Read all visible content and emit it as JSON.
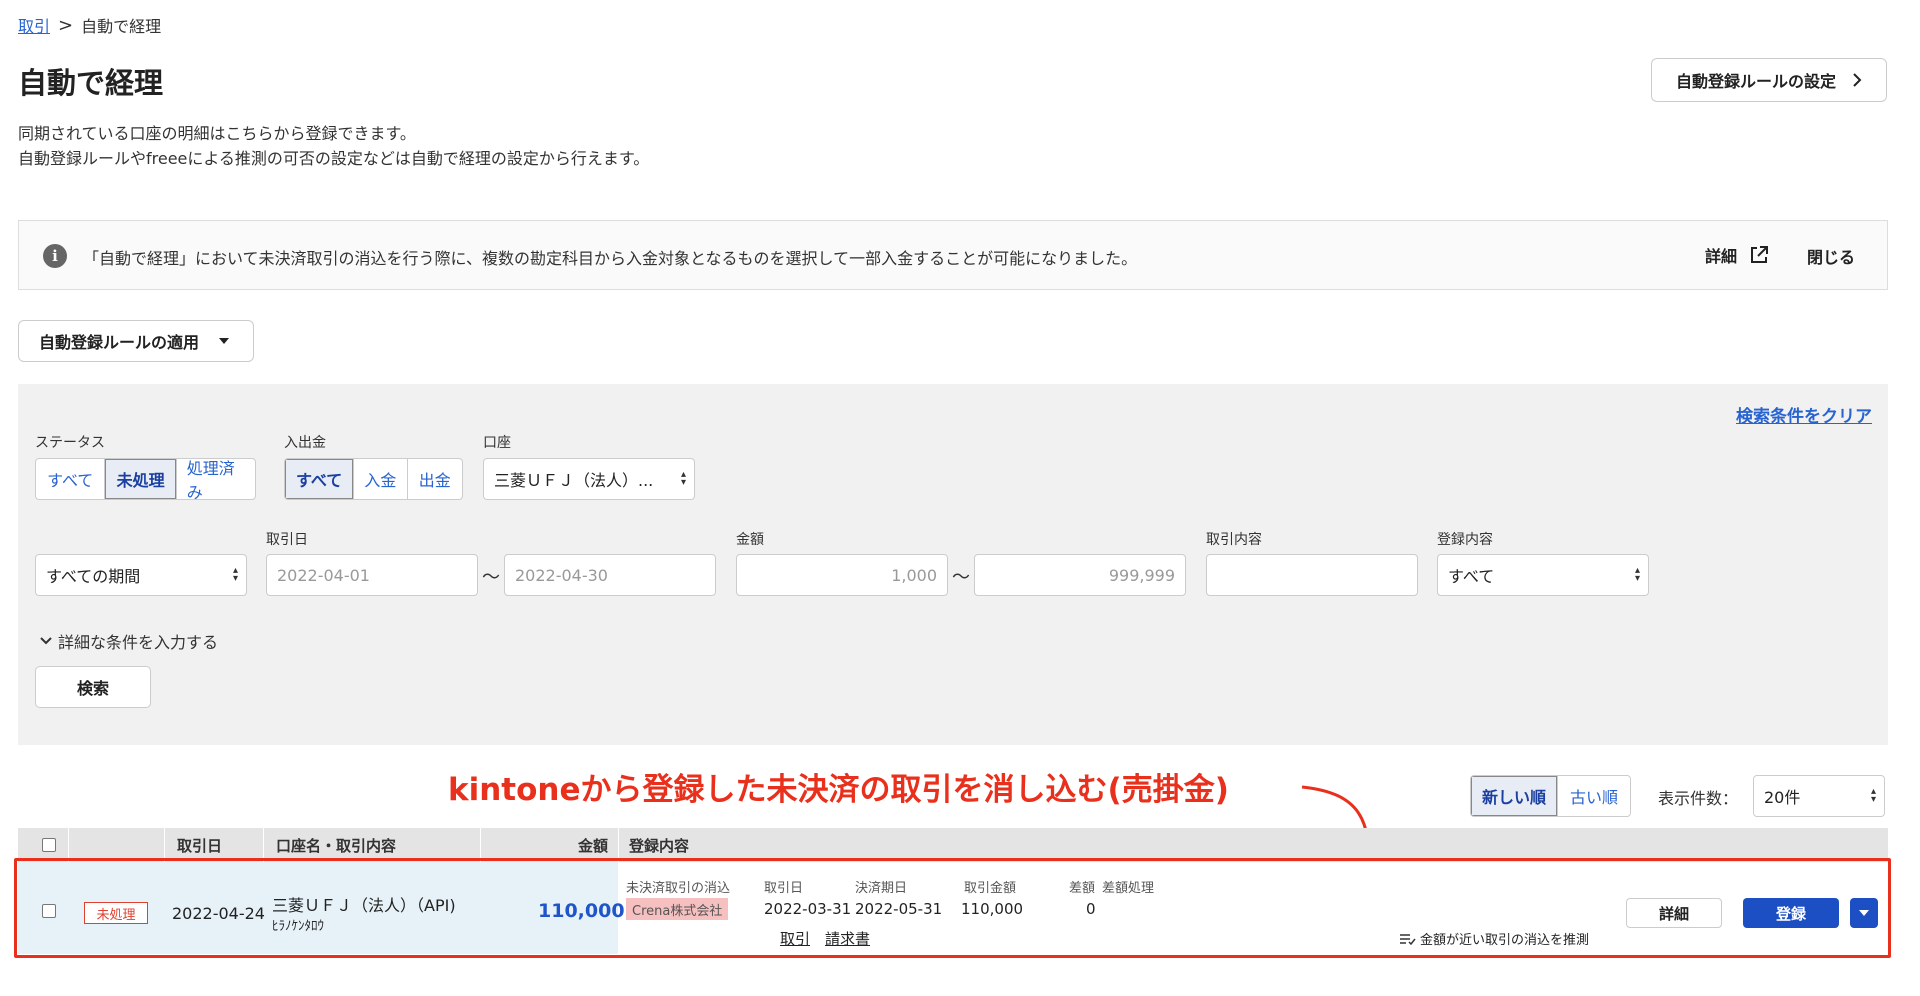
{
  "breadcrumb": {
    "parent": "取引",
    "sep": ">",
    "current": "自動で経理"
  },
  "page": {
    "title": "自動で経理",
    "settings_button": "自動登録ルールの設定",
    "desc_line1": "同期されている口座の明細はこちらから登録できます。",
    "desc_line2": "自動登録ルールやfreeeによる推測の可否の設定などは自動で経理の設定から行えます。"
  },
  "notice": {
    "message": "「自動で経理」において未決済取引の消込を行う際に、複数の勘定科目から入金対象となるものを選択して一部入金することが可能になりました。",
    "detail": "詳細",
    "close": "閉じる"
  },
  "apply_button": "自動登録ルールの適用",
  "filters": {
    "clear": "検索条件をクリア",
    "status_label": "ステータス",
    "status_options": [
      "すべて",
      "未処理",
      "処理済み"
    ],
    "inout_label": "入出金",
    "inout_options": [
      "すべて",
      "入金",
      "出金"
    ],
    "account_label": "口座",
    "account_value": "三菱ＵＦＪ（法人）...",
    "period_value": "すべての期間",
    "date_label": "取引日",
    "date_from": "2022-04-01",
    "date_to": "2022-04-30",
    "tilde": "〜",
    "amount_label": "金額",
    "amount_from": "1,000",
    "amount_to": "999,999",
    "content_label": "取引内容",
    "registered_label": "登録内容",
    "registered_value": "すべて",
    "expand": "詳細な条件を入力する",
    "search": "検索"
  },
  "annotation": "kintoneから登録した未決済の取引を消し込む(売掛金)",
  "sort": {
    "newest": "新しい順",
    "oldest": "古い順"
  },
  "count": {
    "label": "表示件数：",
    "value": "20件"
  },
  "table": {
    "headers": {
      "date": "取引日",
      "account": "口座名・取引内容",
      "amount": "金額",
      "registered": "登録内容"
    },
    "row": {
      "status": "未処理",
      "date": "2022-04-24",
      "account": "三菱ＵＦＪ（法人）（API)",
      "description": "ﾋﾗﾉｹﾝﾀﾛｳ",
      "amount": "110,000",
      "reg_type": "未決済取引の消込",
      "partner": "Crena株式会社",
      "h_date": "取引日",
      "h_due": "決済期日",
      "h_amount": "取引金額",
      "h_diff": "差額",
      "h_diff_proc": "差額処理",
      "v_date": "2022-03-31",
      "v_due": "2022-05-31",
      "v_amount": "110,000",
      "v_diff": "0",
      "link_deal": "取引",
      "link_invoice": "請求書",
      "guess": "金額が近い取引の消込を推測",
      "detail_button": "詳細",
      "register_button": "登録"
    }
  },
  "colors": {
    "accent": "#2864d0",
    "primary_button": "#1d4fc4",
    "annotation": "#e8301c",
    "status": "#e04030"
  }
}
